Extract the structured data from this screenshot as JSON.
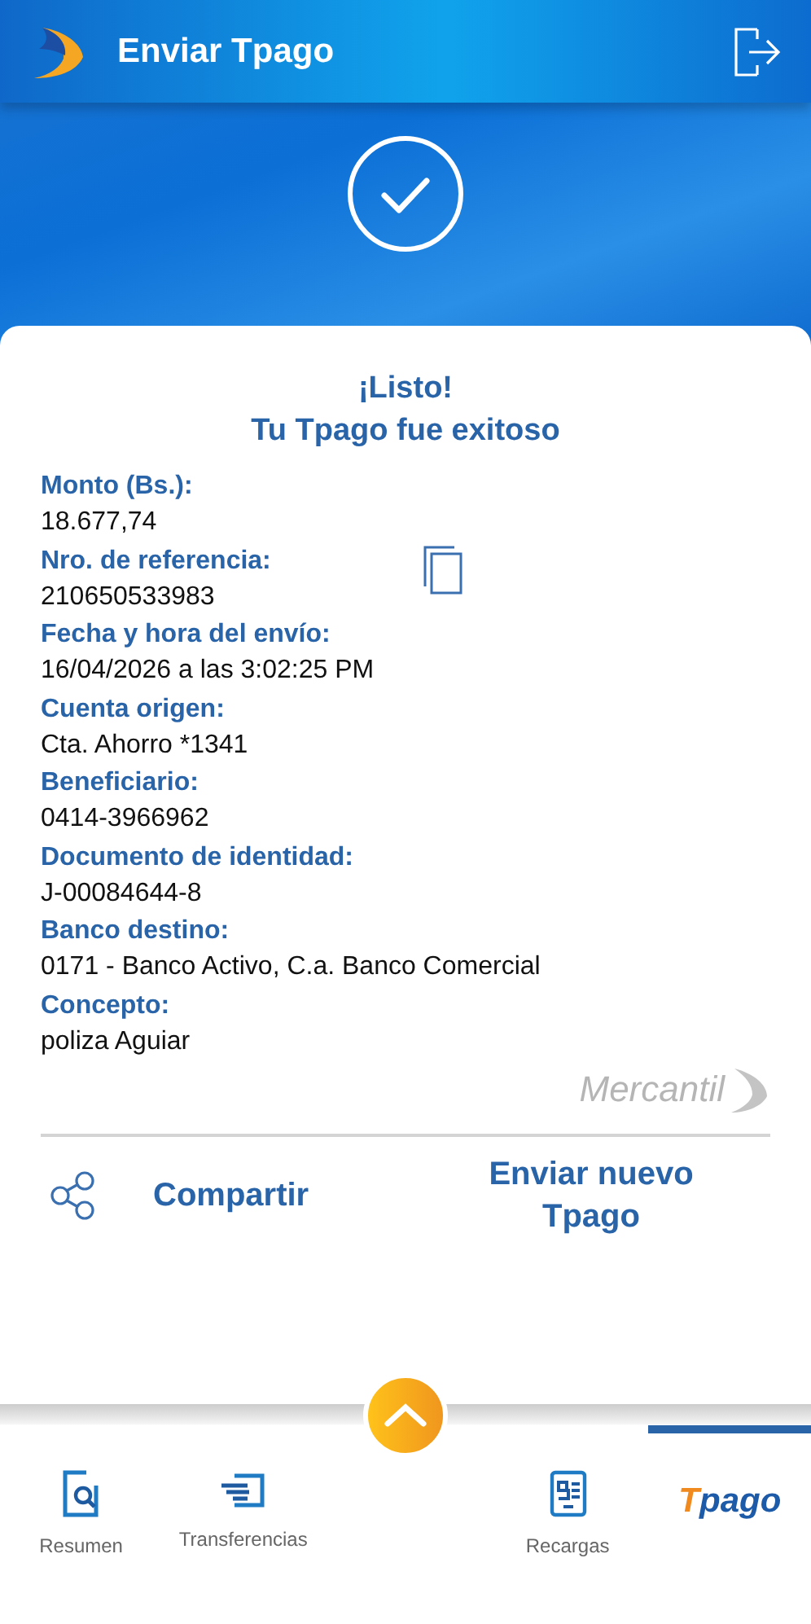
{
  "header": {
    "title": "Enviar Tpago"
  },
  "result": {
    "title": "¡Listo!",
    "subtitle": "Tu Tpago fue exitoso"
  },
  "fields": [
    {
      "label": "Monto (Bs.):",
      "value": "18.677,74",
      "copyable": false
    },
    {
      "label": "Nro. de referencia:",
      "value": "210650533983",
      "copyable": true
    },
    {
      "label": "Fecha y hora del envío:",
      "value": "16/04/2026 a las 3:02:25 PM",
      "copyable": false
    },
    {
      "label": "Cuenta origen:",
      "value": "Cta. Ahorro *1341",
      "copyable": false
    },
    {
      "label": "Beneficiario:",
      "value": "0414-3966962",
      "copyable": false
    },
    {
      "label": "Documento de identidad:",
      "value": "J-00084644-8",
      "copyable": false
    },
    {
      "label": "Banco destino:",
      "value": "0171 - Banco Activo, C.a. Banco Comercial",
      "copyable": false
    },
    {
      "label": "Concepto:",
      "value": "poliza Aguiar",
      "copyable": false
    }
  ],
  "brand": "Mercantil",
  "actions": [
    {
      "label": "Compartir",
      "kind": "share"
    },
    {
      "label": "Enviar nuevo Tpago",
      "kind": "plain"
    }
  ],
  "nav": [
    {
      "kind": "summary",
      "label": "Resumen",
      "selected": false
    },
    {
      "kind": "transfer",
      "label": "Transferencias",
      "selected": false
    },
    {
      "kind": "center"
    },
    {
      "kind": "topup",
      "label": "Recargas",
      "selected": false
    },
    {
      "kind": "logo",
      "logo_prefix": "T",
      "logo_rest": "pago",
      "selected": true
    }
  ]
}
